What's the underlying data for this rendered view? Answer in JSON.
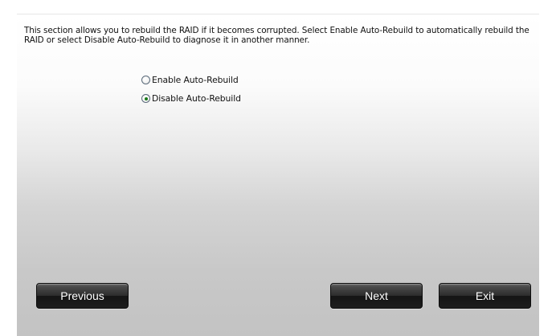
{
  "description": "This section allows you to rebuild the RAID if it becomes corrupted. Select Enable Auto-Rebuild to automatically rebuild the RAID or select Disable Auto-Rebuild to diagnose it in another manner.",
  "options": [
    {
      "label": "Enable Auto-Rebuild",
      "selected": false
    },
    {
      "label": "Disable Auto-Rebuild",
      "selected": true
    }
  ],
  "buttons": {
    "previous": "Previous",
    "next": "Next",
    "exit": "Exit"
  },
  "colors": {
    "button_bg": "#2c2c2c",
    "button_text": "#ffffff",
    "radio_dot": "#1a7a1a"
  }
}
